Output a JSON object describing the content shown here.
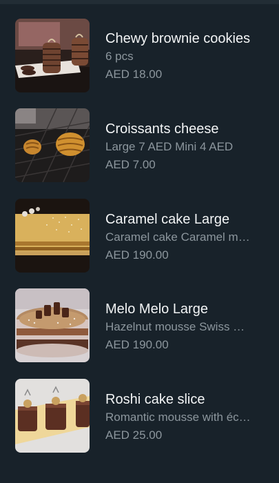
{
  "products": [
    {
      "title": "Chewy brownie cookies",
      "description": "6 pcs",
      "price": "AED 18.00",
      "image_icon": "brownie-cookies-photo"
    },
    {
      "title": "Croissants cheese",
      "description": "Large 7 AED Mini 4 AED",
      "price": "AED 7.00",
      "image_icon": "croissants-photo"
    },
    {
      "title": "Caramel cake Large",
      "description": "Caramel cake Caramel m…",
      "price": "AED 190.00",
      "image_icon": "caramel-cake-photo"
    },
    {
      "title": "Melo Melo Large",
      "description": "Hazelnut mousse Swiss …",
      "price": "AED 190.00",
      "image_icon": "melo-melo-photo"
    },
    {
      "title": "Roshi cake slice",
      "description": "Romantic mousse with éc…",
      "price": "AED 25.00",
      "image_icon": "roshi-cake-photo"
    }
  ],
  "colors": {
    "background": "#18222a",
    "title_text": "#f2f4f5",
    "secondary_text": "#8c969d"
  }
}
